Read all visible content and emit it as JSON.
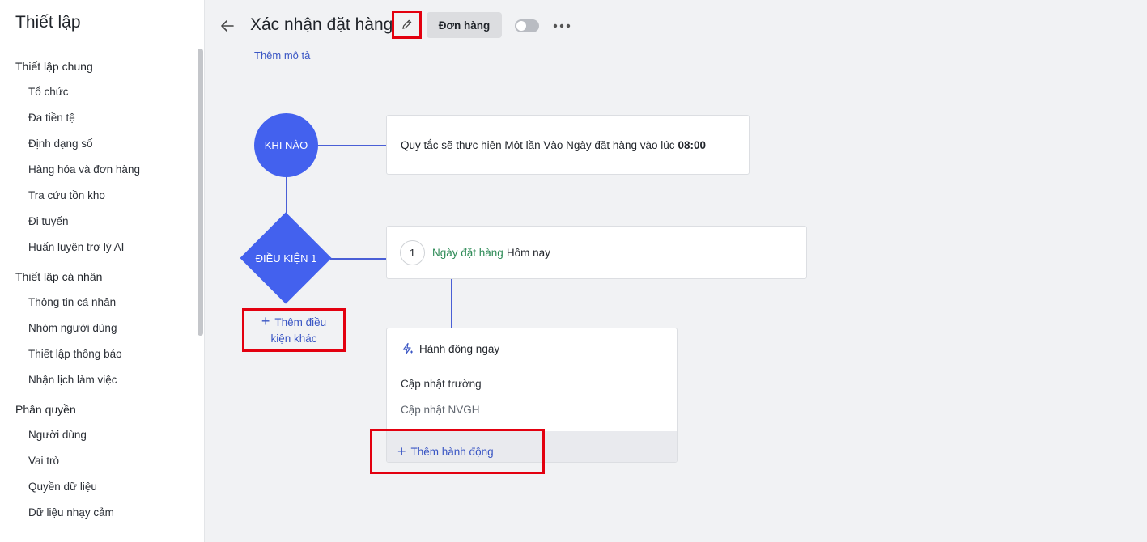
{
  "sidebar": {
    "title": "Thiết lập",
    "groups": [
      {
        "label": "Thiết lập chung",
        "items": [
          "Tổ chức",
          "Đa tiền tệ",
          "Định dạng số",
          "Hàng hóa và đơn hàng",
          "Tra cứu tồn kho",
          "Đi tuyến",
          "Huấn luyện trợ lý AI"
        ]
      },
      {
        "label": "Thiết lập cá nhân",
        "items": [
          "Thông tin cá nhân",
          "Nhóm người dùng",
          "Thiết lập thông báo",
          "Nhận lịch làm việc"
        ]
      },
      {
        "label": "Phân quyền",
        "items": [
          "Người dùng",
          "Vai trò",
          "Quyền dữ liệu",
          "Dữ liệu nhạy cảm"
        ]
      }
    ]
  },
  "header": {
    "title": "Xác nhận đặt hàng",
    "tag_label": "Đơn hàng",
    "add_description": "Thêm mô tả",
    "toggle_on": false
  },
  "flow": {
    "when_label": "KHI NÀO",
    "rule_text": "Quy tắc sẽ thực hiện Một lần Vào Ngày đặt hàng vào lúc",
    "rule_time": "08:00",
    "condition_label": "ĐIỀU KIỆN 1",
    "add_condition_line1": "Thêm điều",
    "add_condition_line2": "kiện khác",
    "condition_number": "1",
    "condition_field": "Ngày đặt hàng",
    "condition_value": "Hôm nay",
    "action_header": "Hành động ngay",
    "action_items": [
      "Cập nhật trường",
      "Cập nhật NVGH"
    ],
    "add_action": "Thêm hành động"
  },
  "colors": {
    "accent": "#4361ee",
    "link": "#3a56c4",
    "highlight": "#e3000f",
    "field_green": "#2e8b57"
  },
  "icons": {
    "back": "arrow-left-icon",
    "edit": "pencil-icon",
    "more": "more-horizontal-icon",
    "plus": "plus-icon",
    "action": "lightning-icon"
  }
}
